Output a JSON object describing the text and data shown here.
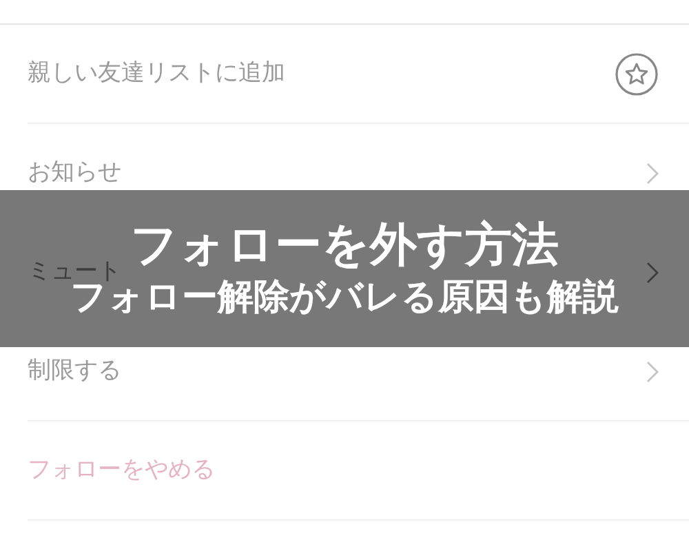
{
  "menu": [
    {
      "label": "親しい友達リストに追加",
      "kind": "star",
      "destructive": false
    },
    {
      "label": "お知らせ",
      "kind": "chevron",
      "destructive": false
    },
    {
      "label": "ミュート",
      "kind": "chevron",
      "destructive": false
    },
    {
      "label": "制限する",
      "kind": "chevron",
      "destructive": false
    },
    {
      "label": "フォローをやめる",
      "kind": "none",
      "destructive": true
    }
  ],
  "banner": {
    "title": "フォローを外す方法",
    "subtitle": "フォロー解除がバレる原因も解説"
  }
}
